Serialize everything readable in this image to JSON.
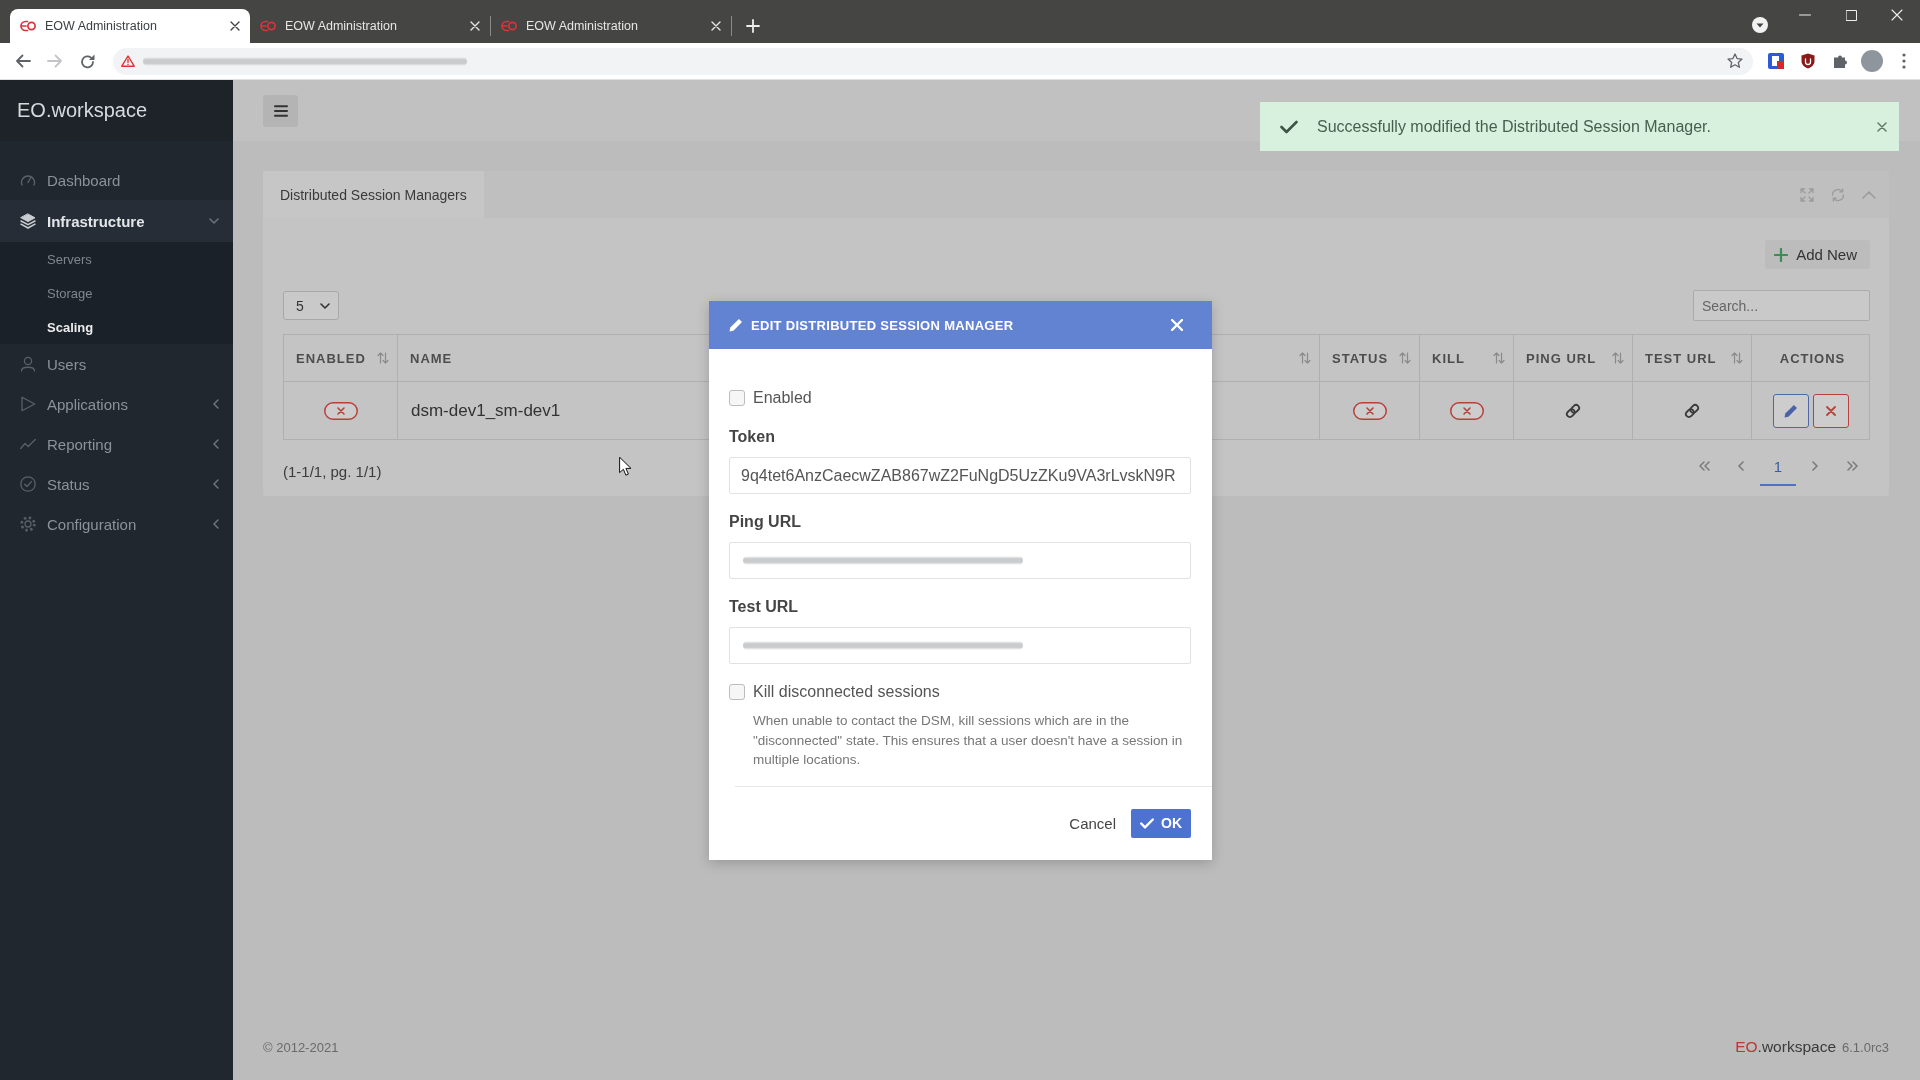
{
  "browser": {
    "tabs": [
      {
        "title": "EOW Administration",
        "selected": true
      },
      {
        "title": "EOW Administration",
        "selected": false
      },
      {
        "title": "EOW Administration",
        "selected": false
      }
    ],
    "forward": {
      "disabled": true
    },
    "address": {
      "blurred": true
    }
  },
  "sidebar": {
    "logo": {
      "mark": "EO",
      "name": ".workspace"
    },
    "items": [
      {
        "label": "Dashboard",
        "selected": false
      },
      {
        "label": "Infrastructure",
        "selected": true,
        "expanded": true,
        "children": [
          {
            "label": "Servers",
            "selected": false
          },
          {
            "label": "Storage",
            "selected": false
          },
          {
            "label": "Scaling",
            "selected": true
          }
        ]
      },
      {
        "label": "Users",
        "selected": false
      },
      {
        "label": "Applications",
        "selected": false,
        "expanded": false
      },
      {
        "label": "Reporting",
        "selected": false,
        "expanded": false
      },
      {
        "label": "Status",
        "selected": false,
        "expanded": false
      },
      {
        "label": "Configuration",
        "selected": false,
        "expanded": false
      }
    ]
  },
  "toast": {
    "message": "Successfully modified the Distributed Session Manager."
  },
  "panel": {
    "title": "Distributed Session Managers",
    "add_button": "Add New",
    "page_size": "5",
    "search": {
      "placeholder": "Search..."
    },
    "table": {
      "columns": [
        {
          "label": "ENABLED",
          "sortable": true
        },
        {
          "label": "NAME"
        },
        {
          "sortable": true
        },
        {
          "label": "STATUS",
          "sortable": true
        },
        {
          "label": "KILL",
          "sortable": true
        },
        {
          "label": "PING URL",
          "sortable": true
        },
        {
          "label": "TEST URL",
          "sortable": true
        },
        {
          "label": "ACTIONS",
          "sortable": false
        }
      ],
      "rows": [
        {
          "cells": [
            {
              "kind": "flag",
              "on": false
            },
            {
              "kind": "text",
              "text": "dsm-dev1_sm-dev1"
            },
            {
              "kind": "blank"
            },
            {
              "kind": "flag",
              "on": false
            },
            {
              "kind": "flag",
              "on": false
            },
            {
              "kind": "link"
            },
            {
              "kind": "link"
            },
            {
              "kind": "actions"
            }
          ]
        }
      ]
    },
    "summary": "(1-1/1, pg. 1/1)",
    "pagination": {
      "pages": [
        {
          "label": "1",
          "selected": true
        }
      ]
    }
  },
  "modal": {
    "title": "EDIT DISTRIBUTED SESSION MANAGER",
    "fields": [
      {
        "kind": "checkbox",
        "label": "Enabled",
        "checked": false
      },
      {
        "kind": "text",
        "label": "Token",
        "value": "9q4tet6AnzCaecwZAB867wZ2FuNgD5UzZKu9VA3rLvskN9R"
      },
      {
        "kind": "text",
        "label": "Ping URL",
        "blurred": true
      },
      {
        "kind": "text",
        "label": "Test URL",
        "blurred": true
      },
      {
        "kind": "checkbox",
        "label": "Kill disconnected sessions",
        "checked": false,
        "help": "When unable to contact the DSM, kill sessions which are in the \"disconnected\" state. This ensures that a user doesn't have a session in multiple locations."
      }
    ],
    "buttons": [
      {
        "kind": "cancel",
        "label": "Cancel"
      },
      {
        "kind": "ok",
        "label": "OK"
      }
    ]
  },
  "footer": {
    "copyright": "© 2012-2021",
    "logo": {
      "mark": "EO",
      "name": ".workspace"
    },
    "version": "6.1.0rc3"
  }
}
